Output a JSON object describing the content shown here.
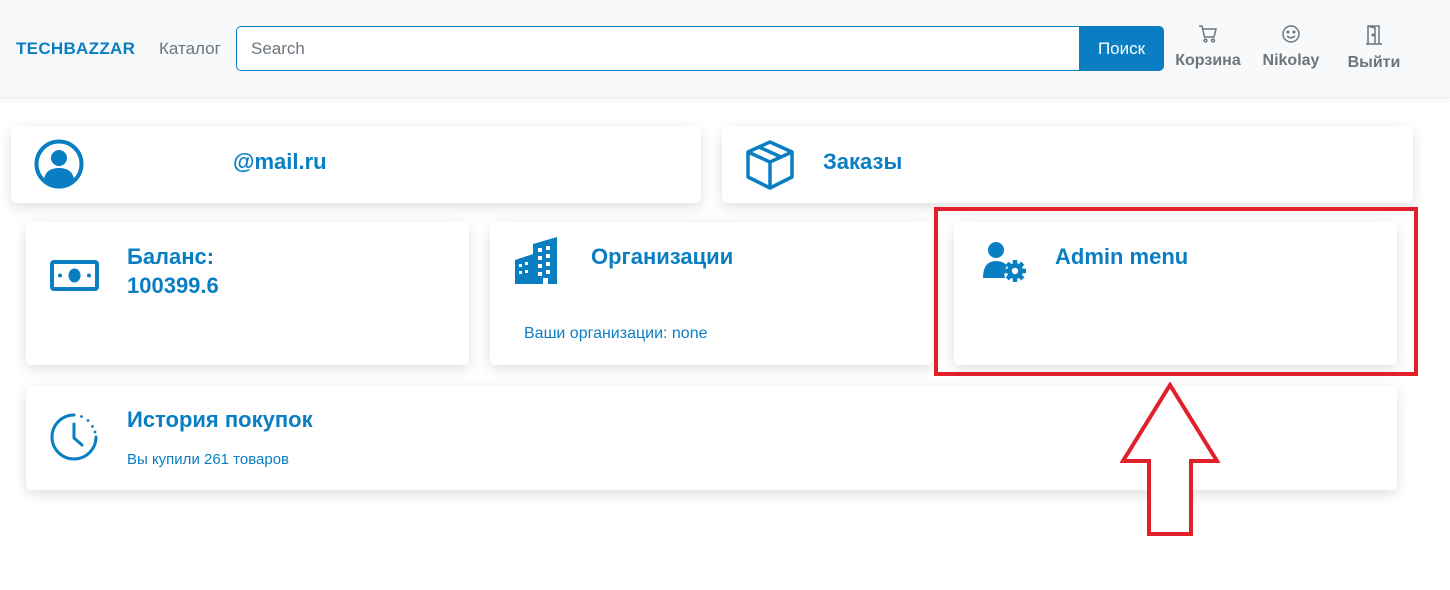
{
  "navbar": {
    "brand": "TECHBAZZAR",
    "catalog_link": "Каталог",
    "search": {
      "placeholder": "Search",
      "value": ""
    },
    "search_button": "Поиск",
    "items": [
      {
        "label": "Корзина",
        "icon": "cart-icon"
      },
      {
        "label": "Nikolay",
        "icon": "smiley-icon"
      },
      {
        "label": "Выйти",
        "icon": "door-icon"
      }
    ]
  },
  "cards": {
    "profile": {
      "email": "@mail.ru",
      "icon": "user-circle-icon"
    },
    "orders": {
      "title": "Заказы",
      "icon": "box-icon"
    },
    "balance": {
      "label": "Баланс:",
      "value": "100399.6",
      "icon": "cash-icon"
    },
    "organizations": {
      "title": "Организации",
      "subtitle": "Ваши организации: none",
      "icon": "buildings-icon"
    },
    "admin": {
      "title": "Admin menu",
      "icon": "user-gear-icon"
    },
    "history": {
      "title": "История покупок",
      "subtitle": "Вы купили 261 товаров",
      "icon": "clock-icon"
    }
  },
  "colors": {
    "accent": "#0a7ec2",
    "highlight": "#e0202b",
    "muted": "#6c757d"
  }
}
